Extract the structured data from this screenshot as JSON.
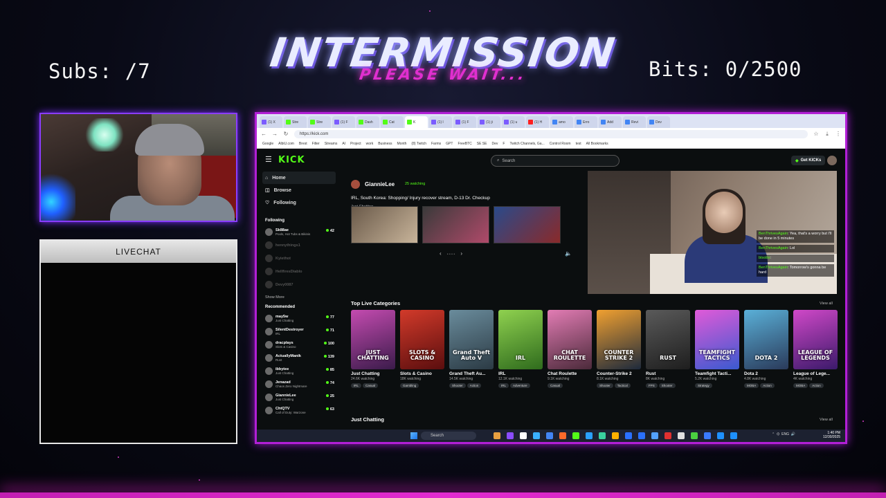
{
  "overlay": {
    "title": "INTERMISSION",
    "subtitle": "PLEASE WAIT...",
    "subs_counter": "Subs: /7",
    "bits_counter": "Bits: 0/2500",
    "livechat_label": "LIVECHAT"
  },
  "browser": {
    "tabs": [
      {
        "label": "(1) X",
        "color": "#7b5cff"
      },
      {
        "label": "Stre",
        "color": "#53fc18"
      },
      {
        "label": "Stre",
        "color": "#53fc18"
      },
      {
        "label": "(1) F",
        "color": "#7b5cff"
      },
      {
        "label": "Dash",
        "color": "#53fc18"
      },
      {
        "label": "Cat",
        "color": "#53fc18"
      },
      {
        "label": "K",
        "color": "#53fc18",
        "active": true
      },
      {
        "label": "(1) l",
        "color": "#7b5cff"
      },
      {
        "label": "(1) F",
        "color": "#7b5cff"
      },
      {
        "label": "(1) ji",
        "color": "#7b5cff"
      },
      {
        "label": "(1) u",
        "color": "#7b5cff"
      },
      {
        "label": "(1) H",
        "color": "#ff2020"
      },
      {
        "label": "amo",
        "color": "#4285f4"
      },
      {
        "label": "Erro",
        "color": "#4285f4"
      },
      {
        "label": "Add",
        "color": "#4285f4"
      },
      {
        "label": "Revi",
        "color": "#4285f4"
      },
      {
        "label": "Dev",
        "color": "#4285f4"
      }
    ],
    "url": "https://kick.com",
    "bookmarks": [
      "Google",
      "AlbiU.com",
      "Brest",
      "Filter",
      "Streams",
      "AI",
      "Project",
      "work",
      "Business",
      "Month",
      "(8) Twitch",
      "Farms",
      "GPT",
      "FreeBTC",
      "SE SE",
      "Dev",
      "F",
      "Twitch Channels, Ga...",
      "Control Room",
      "test",
      "All Bookmarks"
    ]
  },
  "kick": {
    "logo": "KICK",
    "search_placeholder": "Search",
    "get_kicks": "Get KICKs",
    "nav": [
      "Home",
      "Browse",
      "Following"
    ],
    "following_title": "Following",
    "following": [
      {
        "name": "Sk88ae",
        "category": "Pools, Hot Tubs & Bikinis",
        "count": "42",
        "live": true
      },
      {
        "name": "hennythings1",
        "category": "",
        "count": "",
        "live": false
      },
      {
        "name": "Kyiethot",
        "category": "",
        "count": "",
        "live": false
      },
      {
        "name": "HellfiresDiablo",
        "category": "",
        "count": "",
        "live": false
      },
      {
        "name": "Devy0087",
        "category": "",
        "count": "",
        "live": false
      }
    ],
    "show_more": "Show More",
    "recommended_title": "Recommended",
    "recommended": [
      {
        "name": "may5w",
        "category": "Just Chatting",
        "count": "77"
      },
      {
        "name": "SilentDestroyer",
        "category": "IRL",
        "count": "71"
      },
      {
        "name": "dracplays",
        "category": "Slots & Casino",
        "count": "100"
      },
      {
        "name": "ActuallyManik",
        "category": "Rust",
        "count": "139"
      },
      {
        "name": "ibbytee",
        "category": "Just Chatting",
        "count": "85"
      },
      {
        "name": "Jenazad",
        "category": "Chaos Zero Nightmare",
        "count": "74"
      },
      {
        "name": "GiannieLee",
        "category": "Just Chatting",
        "count": "25"
      },
      {
        "name": "ChtQTV",
        "category": "Call of Duty: Warzone",
        "count": "63"
      }
    ],
    "featured": {
      "streamer": "GiannieLee",
      "watching": "25 watching",
      "title": "IRL, South Korea: Shopping/ Injury recover stream, D-13 Dr. Checkup",
      "category": "Just Chatting"
    },
    "overlay_chat": [
      {
        "user": "BenThrivesAgain",
        "text": ": Yea, that's a worry but I'll be done in 5 minutes"
      },
      {
        "user": "BenThrivesAgain",
        "text": ": Lol"
      },
      {
        "user": "btsobo",
        "text": ":"
      },
      {
        "user": "BenThrivesAgain",
        "text": ": Tomorrow's gonna be hard"
      }
    ],
    "top_categories_title": "Top Live Categories",
    "view_all": "View all",
    "categories": [
      {
        "name": "Just Chatting",
        "watching": "24.6K watching",
        "tags": [
          "IRL",
          "Casual"
        ],
        "art": "JUST CHATTING",
        "color1": "#c44bb0",
        "color2": "#3a1b4a"
      },
      {
        "name": "Slots & Casino",
        "watching": "18K watching",
        "tags": [
          "Gambling"
        ],
        "art": "SLOTS & CASINO",
        "color1": "#d23a2a",
        "color2": "#5a0e0e"
      },
      {
        "name": "Grand Theft Au...",
        "watching": "14.5K watching",
        "tags": [
          "Shooter",
          "Action"
        ],
        "art": "Grand Theft Auto V",
        "color1": "#6a8c9c",
        "color2": "#2b3a44"
      },
      {
        "name": "IRL",
        "watching": "12.1K watching",
        "tags": [
          "IRL",
          "Adventure"
        ],
        "art": "IRL",
        "color1": "#8fd14f",
        "color2": "#2f6b1d"
      },
      {
        "name": "Chat Roulette",
        "watching": "9.1K watching",
        "tags": [
          "Casual"
        ],
        "art": "CHAT ROULETTE",
        "color1": "#e27cb4",
        "color2": "#4b2a3a"
      },
      {
        "name": "Counter-Strike 2",
        "watching": "8.1K watching",
        "tags": [
          "Shooter",
          "Tactical"
        ],
        "art": "COUNTER STRIKE 2",
        "color1": "#f0a030",
        "color2": "#1e2a3c"
      },
      {
        "name": "Rust",
        "watching": "8K watching",
        "tags": [
          "FPS",
          "Shooter"
        ],
        "art": "RUST",
        "color1": "#5a5a5a",
        "color2": "#1e1e1e"
      },
      {
        "name": "Teamfight Tacti...",
        "watching": "5.2K watching",
        "tags": [
          "Strategy"
        ],
        "art": "TEAMFIGHT TACTICS",
        "color1": "#e05ad8",
        "color2": "#3a5ad0"
      },
      {
        "name": "Dota 2",
        "watching": "4.8K watching",
        "tags": [
          "MOBA",
          "Action"
        ],
        "art": "DOTA 2",
        "color1": "#5ab0d8",
        "color2": "#2a3a5a"
      },
      {
        "name": "League of Lege...",
        "watching": "4K watching",
        "tags": [
          "MOBA",
          "Action"
        ],
        "art": "LEAGUE OF LEGENDS",
        "color1": "#d048c8",
        "color2": "#3b1a6a"
      }
    ],
    "just_chatting_title": "Just Chatting"
  },
  "taskbar": {
    "search": "Search",
    "icon_colors": [
      "#e8a040",
      "#8a4cff",
      "#ffffff",
      "#3ab0ff",
      "#4285f4",
      "#ff6a2a",
      "#53fc18",
      "#2aa0ff",
      "#3ad0a0",
      "#ffb000",
      "#2a70ff",
      "#2a70ff",
      "#53a0ff",
      "#e03030",
      "#e0e0e0",
      "#4ad040",
      "#3a7aff",
      "#1e90ff",
      "#1e90ff"
    ],
    "tray": "ENG",
    "time": "1:40 PM",
    "date": "12/30/2025"
  }
}
